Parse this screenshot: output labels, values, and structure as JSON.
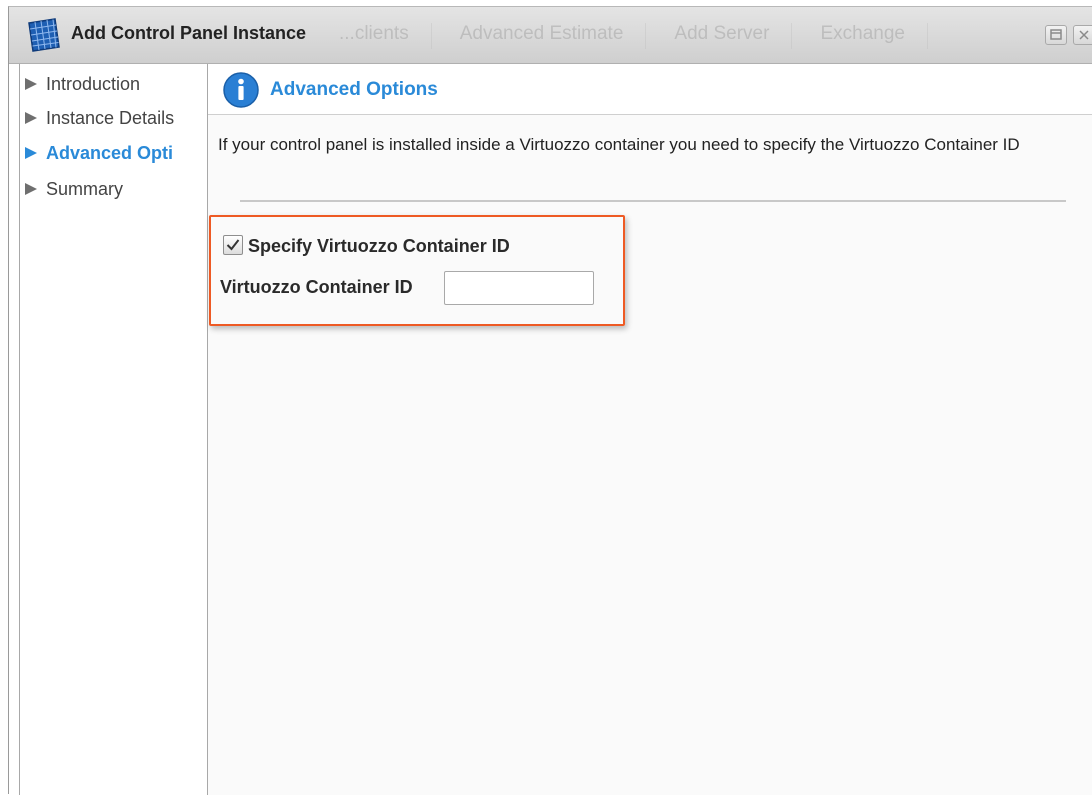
{
  "window": {
    "title": "Add Control Panel Instance",
    "app_icon": "grid-app-icon",
    "controls": [
      "maximize-icon",
      "close-icon"
    ]
  },
  "background_toolbar": {
    "items": [
      "...clients",
      "Advanced Estimate",
      "Add Server",
      "Exchange"
    ]
  },
  "nav": {
    "items": [
      {
        "label": "Introduction",
        "active": false
      },
      {
        "label": "Instance Details",
        "active": false
      },
      {
        "label": "Advanced Opti",
        "active": true
      },
      {
        "label": "Summary",
        "active": false
      }
    ]
  },
  "main": {
    "header_icon": "info-icon",
    "header_title": "Advanced Options",
    "description": "If your control panel is installed inside a Virtuozzo container you need to specify the Virtuozzo Container ID",
    "checkbox": {
      "label": "Specify Virtuozzo Container ID",
      "checked": true
    },
    "field": {
      "label": "Virtuozzo Container ID",
      "value": "",
      "placeholder": ""
    }
  },
  "colors": {
    "accent_blue": "#2a8ad8",
    "highlight_orange": "#ee5a24"
  }
}
